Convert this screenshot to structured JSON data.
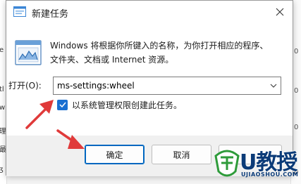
{
  "dialog": {
    "title": "新建任务",
    "description": "Windows 将根据你所键入的名称，为你打开相应的程序、文件夹、文档或 Internet 资源。",
    "open_label": "打开(O):",
    "command_value": "ms-settings:wheel",
    "admin_checkbox": {
      "label": "以系统管理权限创建此任务。",
      "checked": true
    },
    "buttons": {
      "ok": "确定",
      "cancel": "取消",
      "browse": ""
    }
  },
  "background": {
    "left_edge_text": [
      "e",
      "tl",
      "w",
      "理",
      "最",
      "ʒ"
    ],
    "right_edge_text": [
      "0",
      "0",
      "0",
      "0"
    ]
  },
  "watermark": {
    "brand": "U教授",
    "url": "UJIAOSHOU.COM"
  },
  "colors": {
    "accent": "#1a6fd1",
    "arrow": "#e03a3a",
    "watermark_blue": "#0b3b78",
    "watermark_green": "#2e9b3a"
  }
}
